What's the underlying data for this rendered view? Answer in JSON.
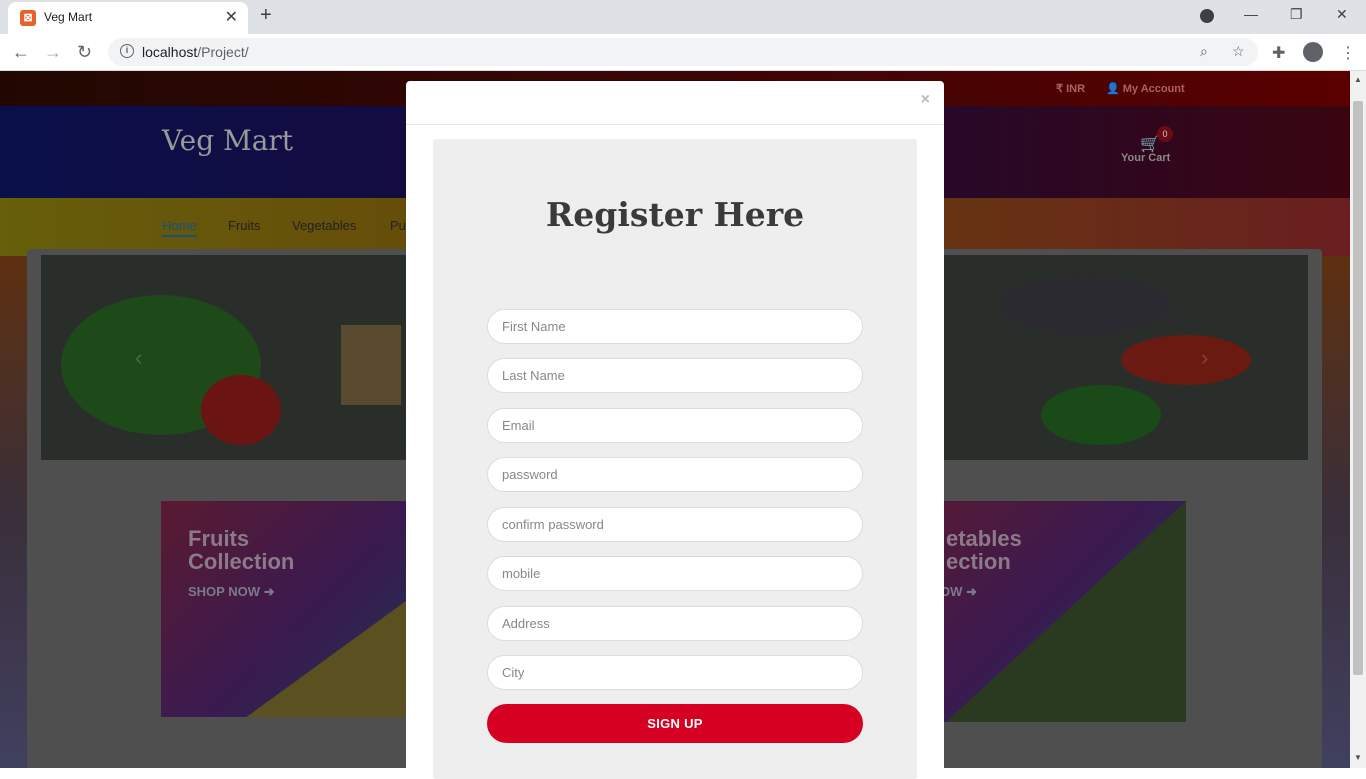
{
  "browser": {
    "tab_title": "Veg Mart",
    "url_host": "localhost",
    "url_path": "/Project/"
  },
  "site": {
    "currency": "INR",
    "account": "My Account",
    "brand": "Veg Mart",
    "cart_count": "0",
    "cart_label": "Your Cart",
    "nav": [
      "Home",
      "Fruits",
      "Vegetables",
      "Pu"
    ],
    "promos": [
      {
        "title_1": "Fruits",
        "title_2": "Collection",
        "shop": "SHOP NOW ➜"
      },
      {
        "title_1": "etables",
        "title_2": "ection",
        "shop": "OW ➜"
      }
    ]
  },
  "modal": {
    "close": "×",
    "title": "Register Here",
    "fields": [
      {
        "placeholder": "First Name"
      },
      {
        "placeholder": "Last Name"
      },
      {
        "placeholder": "Email"
      },
      {
        "placeholder": "password"
      },
      {
        "placeholder": "confirm password"
      },
      {
        "placeholder": "mobile"
      },
      {
        "placeholder": "Address"
      },
      {
        "placeholder": "City"
      }
    ],
    "submit": "SIGN UP"
  },
  "colors": {
    "accent": "#d60023",
    "card_bg": "#eeeeee"
  }
}
